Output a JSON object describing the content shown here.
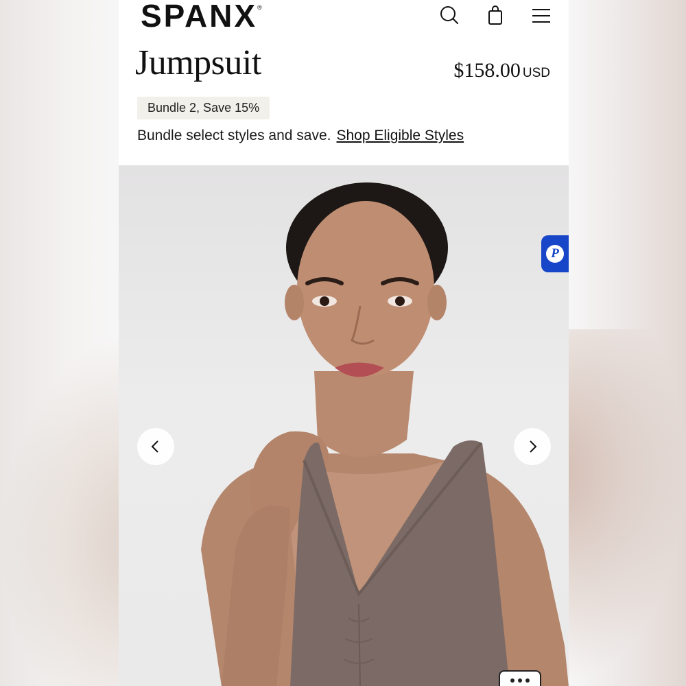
{
  "brand": {
    "logo_text": "SPANX",
    "registered_mark": "®"
  },
  "header": {
    "icons": [
      "search-icon",
      "shopping-bag-icon",
      "hamburger-menu-icon"
    ]
  },
  "product": {
    "title": "Jumpsuit",
    "price": "$158.00",
    "currency": "USD"
  },
  "promo": {
    "badge": "Bundle 2, Save 15%",
    "text": "Bundle select styles and save.",
    "link": "Shop Eligible Styles"
  },
  "gallery": {
    "prev_icon": "chevron-left-icon",
    "next_icon": "chevron-right-icon",
    "garment_color": "#7b6a66"
  },
  "side_tab": {
    "letter": "P",
    "color": "#1747c8"
  },
  "chat": {
    "icon": "chat-ellipsis-icon"
  }
}
